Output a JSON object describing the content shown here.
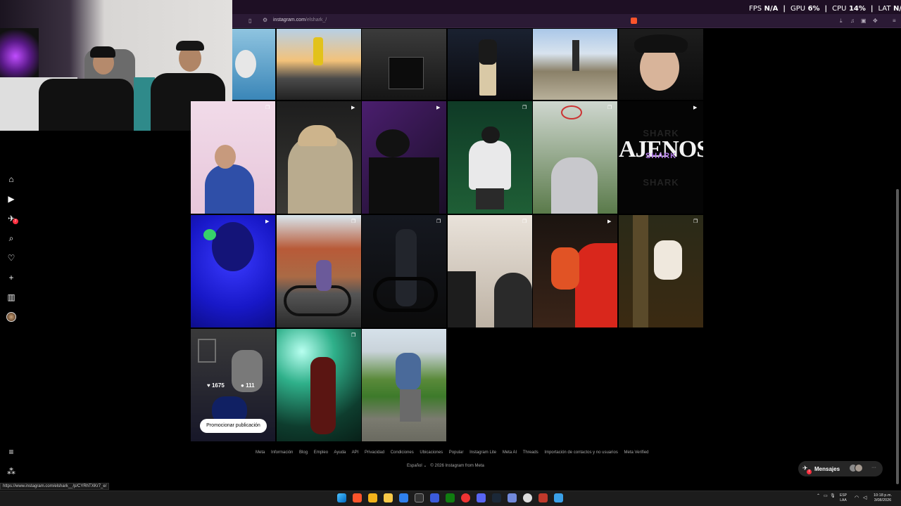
{
  "perf": {
    "fps_label": "FPS",
    "fps_value": "N/A",
    "gpu_label": "GPU",
    "gpu_value": "6%",
    "cpu_label": "CPU",
    "cpu_value": "14%",
    "lat_label": "LAT",
    "lat_value": "N/A"
  },
  "browser": {
    "url_host": "instagram.com",
    "url_path": "/elshark_/",
    "status_url": "https://www.instagram.com/elshark__/p/CYRhTXKr7_e/"
  },
  "sidebar": {
    "icons": [
      "home-icon",
      "reels-icon",
      "messages-icon",
      "search-icon",
      "notifications-icon",
      "create-icon",
      "dashboard-icon",
      "profile-avatar"
    ],
    "notification_badge": "7",
    "bottom_icons": [
      "menu-icon",
      "threads-icon"
    ]
  },
  "grid": {
    "hovered_post": {
      "likes": "1675",
      "comments": "111"
    },
    "promote_label": "Promocionar publicación",
    "text_tile": {
      "main": "AJENOS",
      "ghost_top": "SHARK",
      "overlay": "SHARK",
      "ghost_bottom": "SHARK"
    }
  },
  "footer": {
    "links": [
      "Meta",
      "Información",
      "Blog",
      "Empleo",
      "Ayuda",
      "API",
      "Privacidad",
      "Condiciones",
      "Ubicaciones",
      "Popular",
      "Instagram Lite",
      "Meta AI",
      "Threads",
      "Importación de contactos y no usuarios",
      "Meta Verified"
    ],
    "language": "Español",
    "copyright": "© 2026 Instagram from Meta"
  },
  "messages": {
    "label": "Mensajes",
    "badge": "7",
    "more": "···"
  },
  "taskbar": {
    "lang_top": "ESP",
    "lang_bottom": "LAA",
    "time": "10:18 p.m.",
    "date": "3/08/2026"
  },
  "colors": {
    "background": "#000000",
    "browser_chrome": "#2b1a35",
    "badge": "#ff3040"
  }
}
